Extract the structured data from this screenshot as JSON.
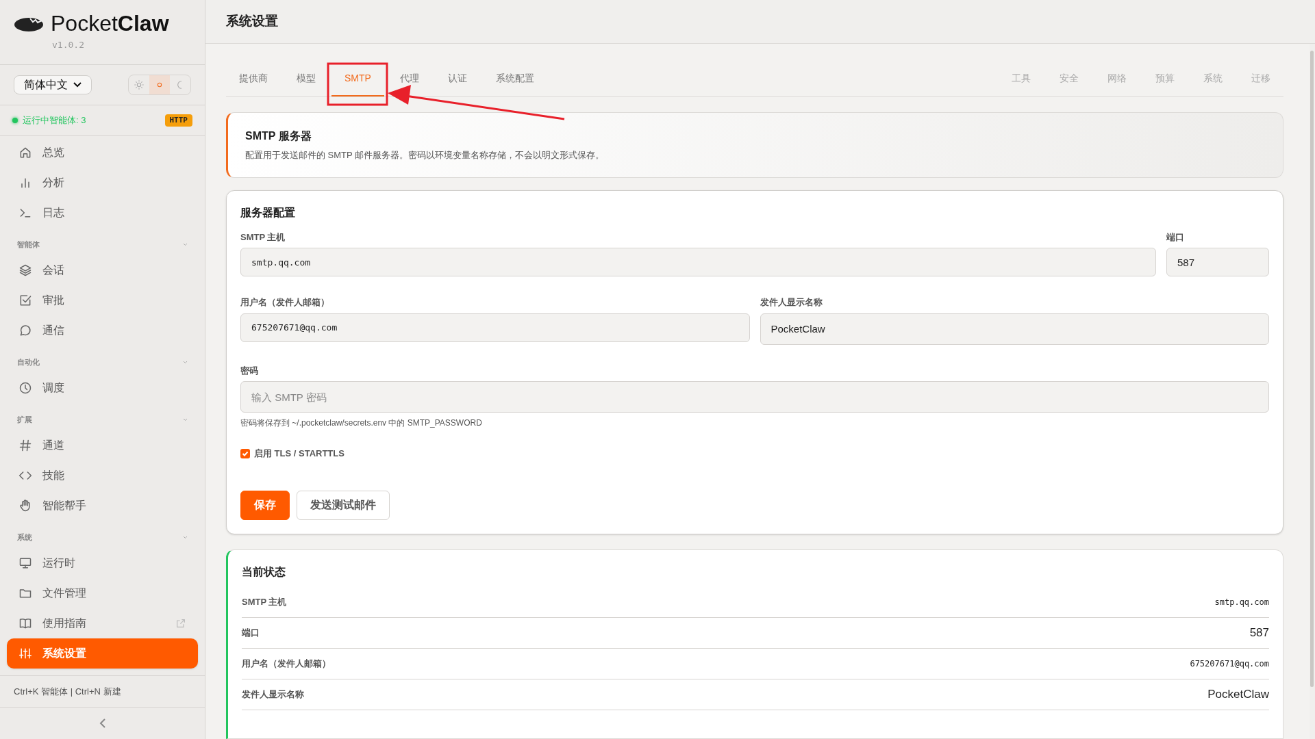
{
  "brand": {
    "name_light": "Pocket",
    "name_bold": "Claw",
    "version": "v1.0.2"
  },
  "language_select": {
    "value": "简体中文"
  },
  "theme_modes": [
    {
      "selected": false
    },
    {
      "selected": true
    },
    {
      "selected": false
    }
  ],
  "status": {
    "text": "运行中智能体: 3",
    "badge": "HTTP"
  },
  "sidebar": {
    "groups": [
      {
        "items": [
          {
            "label": "总览",
            "selected": false
          },
          {
            "label": "分析",
            "selected": false
          },
          {
            "label": "日志",
            "selected": false
          }
        ]
      },
      {
        "title": "智能体",
        "items": [
          {
            "label": "会话",
            "selected": false
          },
          {
            "label": "审批",
            "selected": false
          },
          {
            "label": "通信",
            "selected": false
          }
        ]
      },
      {
        "title": "自动化",
        "items": [
          {
            "label": "调度",
            "selected": false
          }
        ]
      },
      {
        "title": "扩展",
        "items": [
          {
            "label": "通道",
            "selected": false
          },
          {
            "label": "技能",
            "selected": false
          },
          {
            "label": "智能帮手",
            "selected": false
          }
        ]
      },
      {
        "title": "系统",
        "items": [
          {
            "label": "运行时",
            "selected": false
          },
          {
            "label": "文件管理",
            "selected": false
          },
          {
            "label": "使用指南",
            "selected": false,
            "external": true
          },
          {
            "label": "系统设置",
            "selected": true
          }
        ]
      }
    ],
    "shortcut_hint": "Ctrl+K 智能体 | Ctrl+N 新建"
  },
  "page_title": "系统设置",
  "tabs_primary": [
    {
      "label": "提供商",
      "selected": false
    },
    {
      "label": "模型",
      "selected": false
    },
    {
      "label": "SMTP",
      "selected": true
    },
    {
      "label": "代理",
      "selected": false
    },
    {
      "label": "认证",
      "selected": false
    },
    {
      "label": "系统配置",
      "selected": false
    }
  ],
  "tabs_secondary": [
    {
      "label": "工具",
      "selected": false
    },
    {
      "label": "安全",
      "selected": false
    },
    {
      "label": "网络",
      "selected": false
    },
    {
      "label": "预算",
      "selected": false
    },
    {
      "label": "系统",
      "selected": false
    },
    {
      "label": "迁移",
      "selected": false
    }
  ],
  "intro": {
    "title": "SMTP 服务器",
    "description": "配置用于发送邮件的 SMTP 邮件服务器。密码以环境变量名称存储，不会以明文形式保存。"
  },
  "form": {
    "title": "服务器配置",
    "host": {
      "label": "SMTP 主机",
      "value": "smtp.qq.com",
      "mono": true
    },
    "port": {
      "label": "端口",
      "value": "587",
      "mono": false
    },
    "username": {
      "label": "用户名（发件人邮箱）",
      "value": "675207671@qq.com",
      "mono": true
    },
    "sender_name": {
      "label": "发件人显示名称",
      "value": "PocketClaw",
      "mono": false
    },
    "password": {
      "label": "密码",
      "placeholder": "输入 SMTP 密码",
      "hint": "密码将保存到 ~/.pocketclaw/secrets.env 中的 SMTP_PASSWORD"
    },
    "tls": {
      "label": "启用 TLS / STARTTLS",
      "checked": true
    },
    "buttons": [
      {
        "label": "保存",
        "kind": "primary"
      },
      {
        "label": "发送测试邮件",
        "kind": "secondary"
      }
    ]
  },
  "current_status": {
    "title": "当前状态",
    "rows": [
      {
        "label": "SMTP 主机",
        "value": "smtp.qq.com",
        "mono": true
      },
      {
        "label": "端口",
        "value": "587",
        "mono": false
      },
      {
        "label": "用户名（发件人邮箱）",
        "value": "675207671@qq.com",
        "mono": true
      },
      {
        "label": "发件人显示名称",
        "value": "PocketClaw",
        "mono": false
      }
    ]
  }
}
